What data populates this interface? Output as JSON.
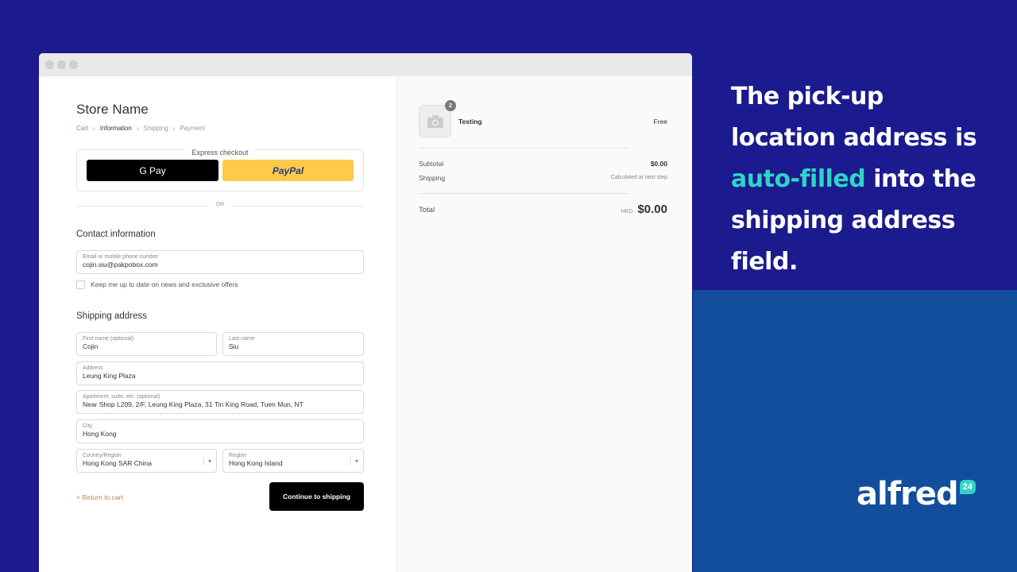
{
  "store": {
    "name": "Store Name",
    "breadcrumb": [
      "Cart",
      "Information",
      "Shipping",
      "Payment"
    ],
    "express_label": "Express checkout",
    "gpay_label": "G Pay",
    "paypal_label": "PayPal",
    "or_label": "OR",
    "contact": {
      "title": "Contact information",
      "email_label": "Email or mobile phone number",
      "email_value": "cojin.siu@pakpobox.com",
      "newsletter_label": "Keep me up to date on news and exclusive offers",
      "newsletter_checked": false
    },
    "shipping": {
      "title": "Shipping address",
      "first_name": {
        "label": "First name (optional)",
        "value": "Cojin"
      },
      "last_name": {
        "label": "Last name",
        "value": "Siu"
      },
      "address": {
        "label": "Address",
        "value": "Leung King Plaza"
      },
      "apartment": {
        "label": "Apartment, suite, etc. (optional)",
        "value": "Near Shop L209, 2/F, Leung King Plaza, 31 Tin King Road, Tuen Mun, NT"
      },
      "city": {
        "label": "City",
        "value": "Hong Kong"
      },
      "country": {
        "label": "Country/Region",
        "value": "Hong Kong SAR China"
      },
      "region": {
        "label": "Region",
        "value": "Hong Kong Island"
      }
    },
    "return_label": "< Return to cart",
    "continue_label": "Continue to shipping"
  },
  "summary": {
    "item_name": "Testing",
    "item_price": "Free",
    "item_qty": "2",
    "subtotal_label": "Subtotal",
    "subtotal_value": "$0.00",
    "shipping_label": "Shipping",
    "shipping_value": "Calculated at next step",
    "total_label": "Total",
    "currency": "HKD",
    "total_value": "$0.00"
  },
  "caption": {
    "line1": "The pick-up location address is",
    "highlight": "auto-filled",
    "line2": "into the shipping address field."
  },
  "logo": {
    "text": "alfred",
    "badge": "24"
  },
  "colors": {
    "background": "#1b1a8e",
    "panel": "#134e9c",
    "accent": "#2fd4c6"
  }
}
